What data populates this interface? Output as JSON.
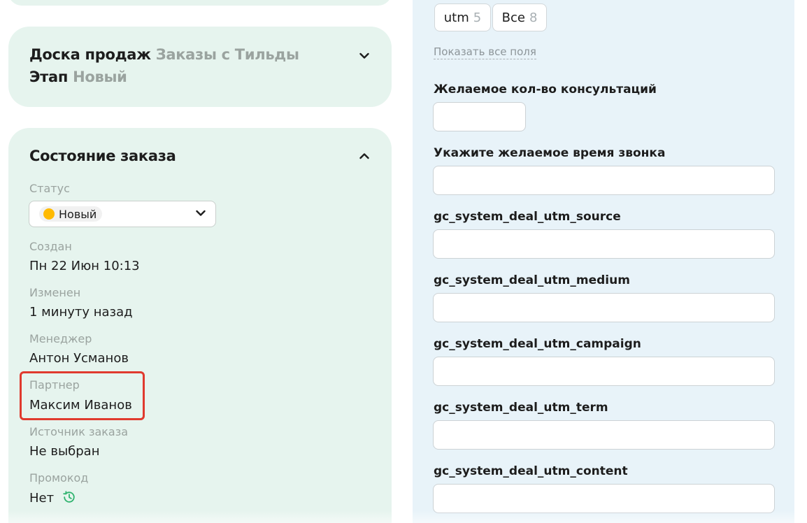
{
  "pipeline": {
    "board_label": "Доска продаж",
    "board_value": "Заказы с Тильды",
    "stage_label": "Этап",
    "stage_value": "Новый"
  },
  "order_state": {
    "title": "Состояние заказа",
    "status": {
      "label": "Статус",
      "value": "Новый",
      "color": "#ffba00"
    },
    "created": {
      "label": "Создан",
      "value": "Пн 22 Июн 10:13"
    },
    "modified": {
      "label": "Изменен",
      "value": "1 минуту назад"
    },
    "manager": {
      "label": "Менеджер",
      "value": "Антон Усманов"
    },
    "partner": {
      "label": "Партнер",
      "value": "Максим Иванов"
    },
    "source": {
      "label": "Источник заказа",
      "value": "Не выбран"
    },
    "promo": {
      "label": "Промокод",
      "value": "Нет",
      "icon": "history-icon"
    }
  },
  "fields_panel": {
    "tabs": [
      {
        "label": "utm",
        "count": "5"
      },
      {
        "label": "Все",
        "count": "8"
      }
    ],
    "show_all_link": "Показать все поля",
    "fields": [
      {
        "label": "Желаемое кол-во консультаций",
        "value": ""
      },
      {
        "label": "Укажите желаемое время звонка",
        "value": ""
      },
      {
        "label": "gc_system_deal_utm_source",
        "value": ""
      },
      {
        "label": "gc_system_deal_utm_medium",
        "value": ""
      },
      {
        "label": "gc_system_deal_utm_campaign",
        "value": ""
      },
      {
        "label": "gc_system_deal_utm_term",
        "value": ""
      },
      {
        "label": "gc_system_deal_utm_content",
        "value": ""
      }
    ]
  },
  "colors": {
    "card_bg": "#e6f4ee",
    "panel_bg": "#e8f3f9",
    "highlight": "#e03a2e",
    "accent_green": "#2fb36e"
  }
}
